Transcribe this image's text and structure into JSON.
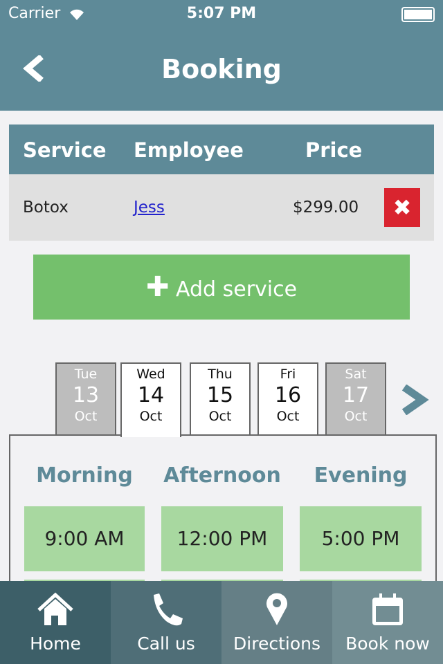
{
  "status": {
    "carrier": "Carrier",
    "time": "5:07 PM"
  },
  "header": {
    "title": "Booking"
  },
  "table": {
    "headers": [
      "Service",
      "Employee",
      "Price"
    ],
    "rows": [
      {
        "service": "Botox",
        "employee": "Jess",
        "price": "$299.00"
      }
    ]
  },
  "add_service": "Add service",
  "dates": [
    {
      "day": "Tue",
      "num": "13",
      "month": "Oct",
      "available": false
    },
    {
      "day": "Wed",
      "num": "14",
      "month": "Oct",
      "available": true,
      "selected": true
    },
    {
      "day": "Thu",
      "num": "15",
      "month": "Oct",
      "available": true
    },
    {
      "day": "Fri",
      "num": "16",
      "month": "Oct",
      "available": true
    },
    {
      "day": "Sat",
      "num": "17",
      "month": "Oct",
      "available": false
    }
  ],
  "periods": [
    {
      "label": "Morning",
      "slots": [
        "9:00 AM"
      ]
    },
    {
      "label": "Afternoon",
      "slots": [
        "12:00 PM"
      ]
    },
    {
      "label": "Evening",
      "slots": [
        "5:00 PM"
      ]
    }
  ],
  "tabbar": [
    {
      "label": "Home",
      "icon": "home-icon"
    },
    {
      "label": "Call us",
      "icon": "phone-icon"
    },
    {
      "label": "Directions",
      "icon": "map-pin-icon"
    },
    {
      "label": "Book now",
      "icon": "calendar-icon"
    }
  ],
  "colors": {
    "primary": "#5e8a98",
    "green": "#74c06c",
    "slot": "#a8d8a0",
    "delete": "#d9242f"
  }
}
